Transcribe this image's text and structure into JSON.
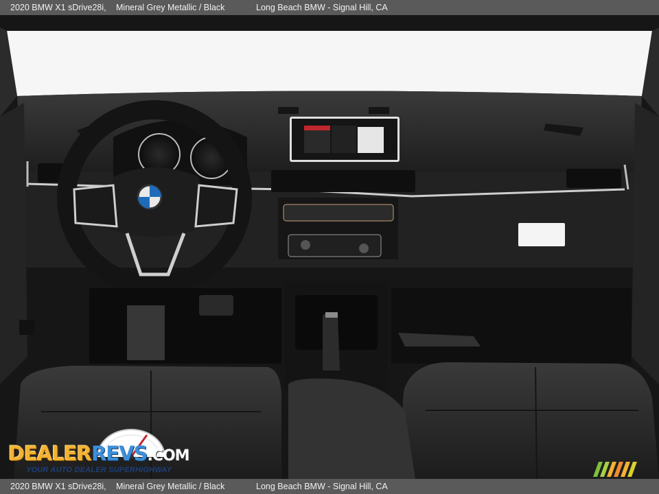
{
  "caption": {
    "model": "2020 BMW X1 sDrive28i,",
    "color": "Mineral Grey Metallic / Black",
    "dealer": "Long Beach BMW - Signal Hill, CA"
  },
  "photo": {
    "subject": "interior dashboard",
    "colors": {
      "interior": "#1c1c1c",
      "trim": "#c9c9c9",
      "windshield": "#f5f5f5"
    }
  },
  "watermark": {
    "brand_a": "DEALER",
    "brand_b": "REVS",
    "brand_c": ".COM",
    "tagline": "YOUR AUTO DEALER SUPERHIGHWAY"
  }
}
